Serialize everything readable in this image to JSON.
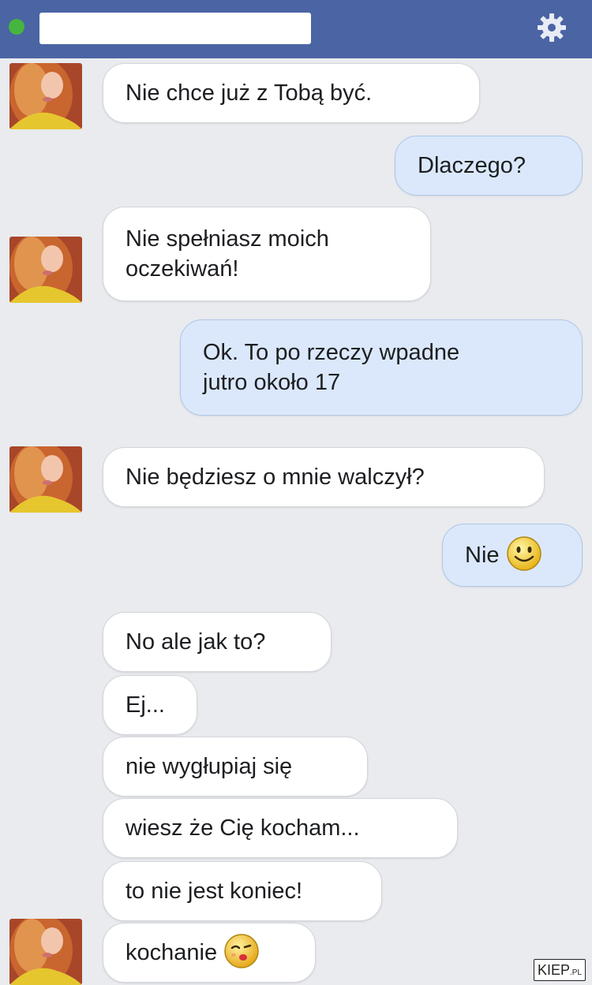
{
  "header": {
    "title": "",
    "status": "online",
    "settings_icon": "gear-icon",
    "colors": {
      "bar": "#4b64a3",
      "status_dot": "#45b53f"
    }
  },
  "messages": [
    {
      "sender": "them",
      "text": "Nie chce już z Tobą być."
    },
    {
      "sender": "me",
      "text": "Dlaczego?"
    },
    {
      "sender": "them",
      "lines": [
        "Nie spełniasz moich",
        "oczekiwań!"
      ]
    },
    {
      "sender": "me",
      "lines": [
        "Ok. To po rzeczy wpadne",
        "jutro około 17"
      ]
    },
    {
      "sender": "them",
      "text": "Nie będziesz o mnie walczył?"
    },
    {
      "sender": "me",
      "text": "Nie",
      "emoji": "smiley-emoji"
    },
    {
      "sender": "them",
      "text": "No ale jak to?"
    },
    {
      "sender": "them",
      "text": "Ej..."
    },
    {
      "sender": "them",
      "text": "nie wygłupiaj się"
    },
    {
      "sender": "them",
      "text": "wiesz że Cię kocham..."
    },
    {
      "sender": "them",
      "text": "to nie jest koniec!"
    },
    {
      "sender": "them",
      "text": "kochanie",
      "emoji": "kiss-wink-emoji"
    }
  ],
  "bubble_colors": {
    "incoming": "#ffffff",
    "outgoing": "#dbe8fb"
  },
  "watermark": {
    "main": "KIEP",
    "suffix": ".PL"
  }
}
